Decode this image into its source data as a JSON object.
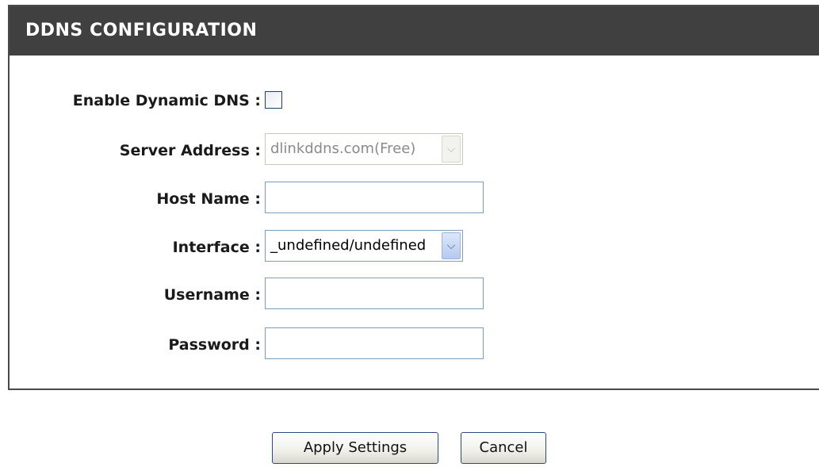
{
  "header": {
    "title": "DDNS CONFIGURATION"
  },
  "form": {
    "enable_ddns": {
      "label": "Enable Dynamic DNS :",
      "checked": false
    },
    "server_address": {
      "label": "Server Address :",
      "value": "dlinkddns.com(Free)",
      "disabled": true
    },
    "host_name": {
      "label": "Host Name :",
      "value": ""
    },
    "interface": {
      "label": "Interface :",
      "value": "_undefined/undefined"
    },
    "username": {
      "label": "Username :",
      "value": ""
    },
    "password": {
      "label": "Password :",
      "value": ""
    }
  },
  "icons": {
    "dropdown": "chevron-down-icon"
  },
  "actions": {
    "apply_label": "Apply Settings",
    "cancel_label": "Cancel"
  }
}
